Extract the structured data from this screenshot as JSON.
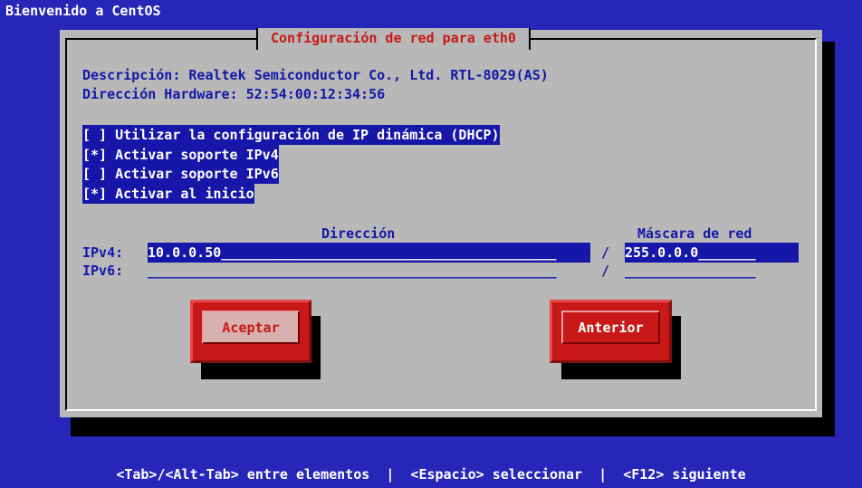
{
  "top_bar": {
    "title": "Bienvenido a CentOS"
  },
  "dialog": {
    "title": "Configuración de red para eth0",
    "description_line": "Descripción: Realtek Semiconductor Co., Ltd. RTL-8029(AS)",
    "hardware_line": "Dirección Hardware: 52:54:00:12:34:56",
    "options": [
      {
        "text": "[ ] Utilizar la configuración de IP dinámica (DHCP)",
        "checked": false,
        "focused": true
      },
      {
        "text": "[*] Activar soporte IPv4",
        "checked": true
      },
      {
        "text": "[ ] Activar soporte IPv6",
        "checked": false
      },
      {
        "text": "[*] Activar al inicio",
        "checked": true
      }
    ],
    "headers": {
      "address": "Dirección",
      "netmask": "Máscara de red"
    },
    "ipv4": {
      "label": "IPv4:",
      "address": "10.0.0.50_________________________________________",
      "separator": "/",
      "netmask": "255.0.0.0_______"
    },
    "ipv6": {
      "label": "IPv6:",
      "address": "__________________________________________________",
      "separator": "/",
      "netmask": "________________"
    },
    "buttons": {
      "ok": "Aceptar",
      "back": "Anterior"
    }
  },
  "help_bar": "<Tab>/<Alt-Tab> entre elementos  |  <Espacio> seleccionar  |  <F12> siguiente",
  "colors": {
    "background": "#2626b8",
    "dialog": "#b8b8b8",
    "text_blue": "#1616a8",
    "accent_red": "#c81818"
  }
}
